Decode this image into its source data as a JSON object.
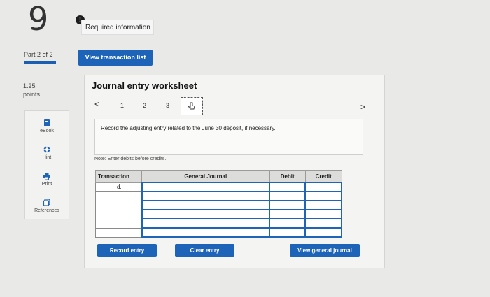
{
  "question": {
    "number": "9"
  },
  "required": {
    "icon": "exclamation-icon",
    "label": "Required information"
  },
  "part": {
    "label": "Part 2 of 2"
  },
  "points": {
    "value": "1.25",
    "unit": "points"
  },
  "toolbar": {
    "view_transactions_label": "View transaction list"
  },
  "sidebar": {
    "items": [
      {
        "label": "eBook",
        "icon": "book-icon"
      },
      {
        "label": "Hint",
        "icon": "lifebuoy-icon"
      },
      {
        "label": "Print",
        "icon": "printer-icon"
      },
      {
        "label": "References",
        "icon": "references-icon"
      }
    ]
  },
  "worksheet": {
    "title": "Journal entry worksheet",
    "nav": {
      "prev": "<",
      "next": ">",
      "pages": [
        "1",
        "2",
        "3"
      ],
      "active_icon": "hand-pointer-icon"
    },
    "instruction": "Record the adjusting entry related to the June 30 deposit, if necessary.",
    "note": "Note: Enter debits before credits.",
    "table": {
      "headers": [
        "Transaction",
        "General Journal",
        "Debit",
        "Credit"
      ],
      "rows": [
        [
          "d.",
          "",
          "",
          ""
        ],
        [
          "",
          "",
          "",
          ""
        ],
        [
          "",
          "",
          "",
          ""
        ],
        [
          "",
          "",
          "",
          ""
        ],
        [
          "",
          "",
          "",
          ""
        ],
        [
          "",
          "",
          "",
          ""
        ]
      ]
    },
    "buttons": {
      "record": "Record entry",
      "clear": "Clear entry",
      "general_journal": "View general journal"
    }
  },
  "colors": {
    "accent": "#1d63b8",
    "background": "#e9e9e7"
  }
}
